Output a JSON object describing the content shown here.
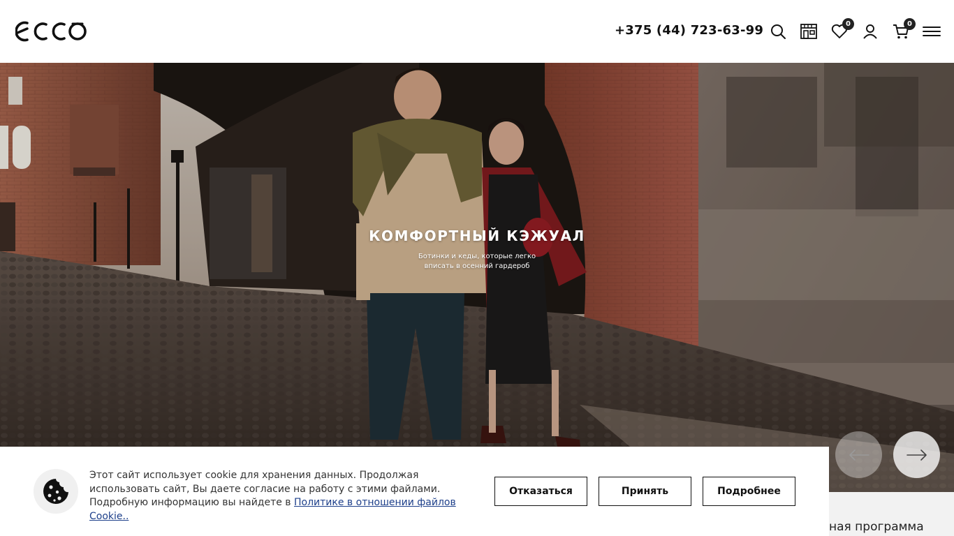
{
  "header": {
    "logo_text": "ecco",
    "phone": "+375 (44) 723-63-99",
    "wishlist_count": "0",
    "cart_count": "0",
    "icons": [
      "search-icon",
      "store-icon",
      "heart-icon",
      "user-icon",
      "cart-icon",
      "menu-icon"
    ]
  },
  "hero": {
    "title": "КОМФОРТНЫЙ КЭЖУАЛ",
    "subtitle_line1": "Ботинки и кеды, которые легко",
    "subtitle_line2": "вписать в осенний гардероб"
  },
  "below": {
    "partial_text": "ная программа"
  },
  "cookie": {
    "text": "Этот сайт использует cookie для хранения данных. Продолжая использовать сайт, Вы даете согласие на работу с этими файлами. Подробную информацию вы найдете в ",
    "link_text": "Политике в отношении файлов Cookie..",
    "decline_label": "Отказаться",
    "accept_label": "Принять",
    "more_label": "Подробнее"
  },
  "colors": {
    "text": "#111111",
    "link": "#1d3f8a",
    "badge": "#222222"
  }
}
